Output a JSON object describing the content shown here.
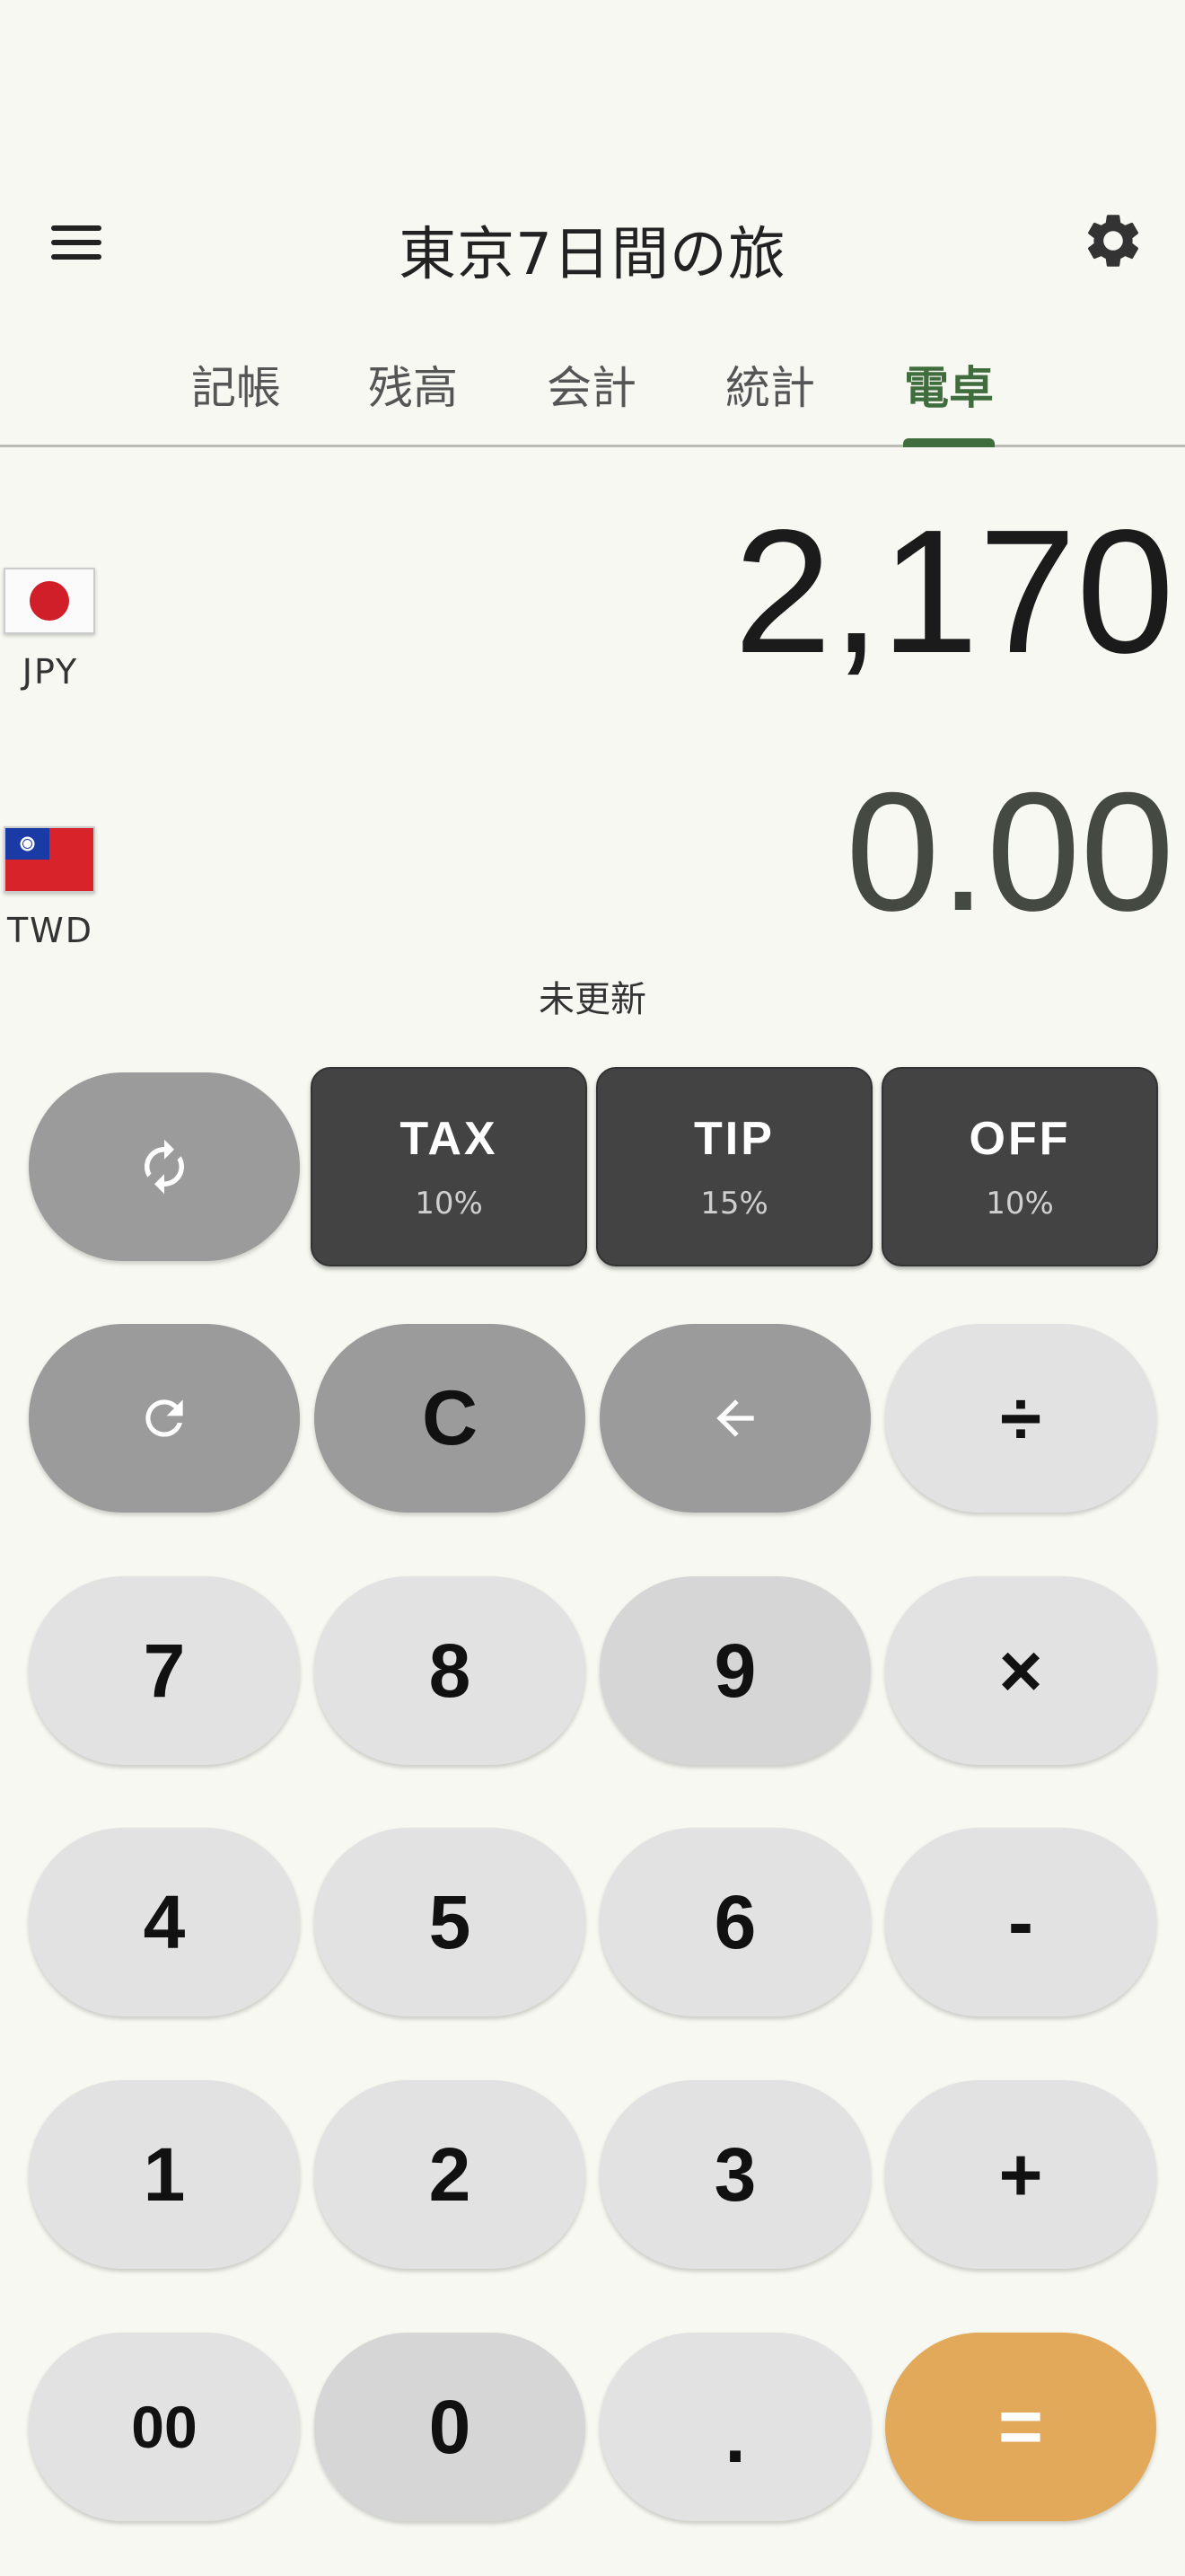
{
  "app": {
    "title": "東京7日間の旅"
  },
  "tabs": [
    {
      "label": "記帳"
    },
    {
      "label": "残高"
    },
    {
      "label": "会計"
    },
    {
      "label": "統計"
    },
    {
      "label": "電卓",
      "active": true
    }
  ],
  "currencies": {
    "primary": {
      "code": "JPY",
      "value": "2,170",
      "flag": "japan-flag-icon"
    },
    "secondary": {
      "code": "TWD",
      "value": "0.00",
      "flag": "taiwan-flag-icon"
    }
  },
  "rate_status": "未更新",
  "modifiers": [
    {
      "label": "TAX",
      "percent": "10%"
    },
    {
      "label": "TIP",
      "percent": "15%"
    },
    {
      "label": "OFF",
      "percent": "10%"
    }
  ],
  "keys": {
    "clear": "C",
    "divide": "÷",
    "multiply": "×",
    "minus": "-",
    "plus": "+",
    "equals": "=",
    "double_zero": "00",
    "zero": "0",
    "dot": ".",
    "one": "1",
    "two": "2",
    "three": "3",
    "four": "4",
    "five": "5",
    "six": "6",
    "seven": "7",
    "eight": "8",
    "nine": "9"
  },
  "icons": {
    "menu": "menu-icon",
    "settings": "gear-icon",
    "swap": "swap-icon",
    "refresh": "refresh-icon",
    "backspace": "backspace-arrow-icon"
  },
  "colors": {
    "background": "#f6f8f1",
    "accent": "#3f6d3d",
    "equals": "#e3a95a",
    "modifier": "#434343"
  }
}
